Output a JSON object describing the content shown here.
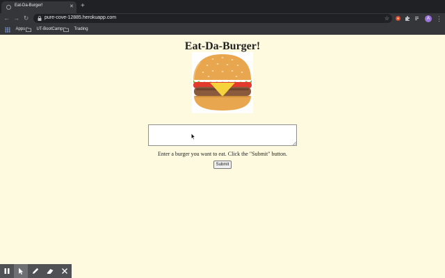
{
  "browser": {
    "tab_title": "Eat-Da-Burger!",
    "url": "pure-cove-12885.herokuapp.com",
    "profile_initial": "A",
    "bookmarks": [
      {
        "label": "Apps",
        "icon": "apps-grid-icon"
      },
      {
        "label": "UT-BootCamp",
        "icon": "folder-icon"
      },
      {
        "label": "Trading",
        "icon": "folder-icon"
      }
    ]
  },
  "page": {
    "title": "Eat-Da-Burger!",
    "input_value": "",
    "instructions": "Enter a burger you want to eat. Click the \"Submit\" button.",
    "submit_label": "Submit"
  },
  "annotation_toolbar": {
    "tools": [
      "pause-icon",
      "pointer-icon",
      "pen-icon",
      "eraser-icon",
      "close-icon"
    ],
    "active_tool": "pointer-icon"
  },
  "colors": {
    "page_background": "#fdfadf",
    "chrome_dark": "#202124",
    "chrome_toolbar": "#35363a",
    "profile_avatar": "#9a74d6"
  }
}
